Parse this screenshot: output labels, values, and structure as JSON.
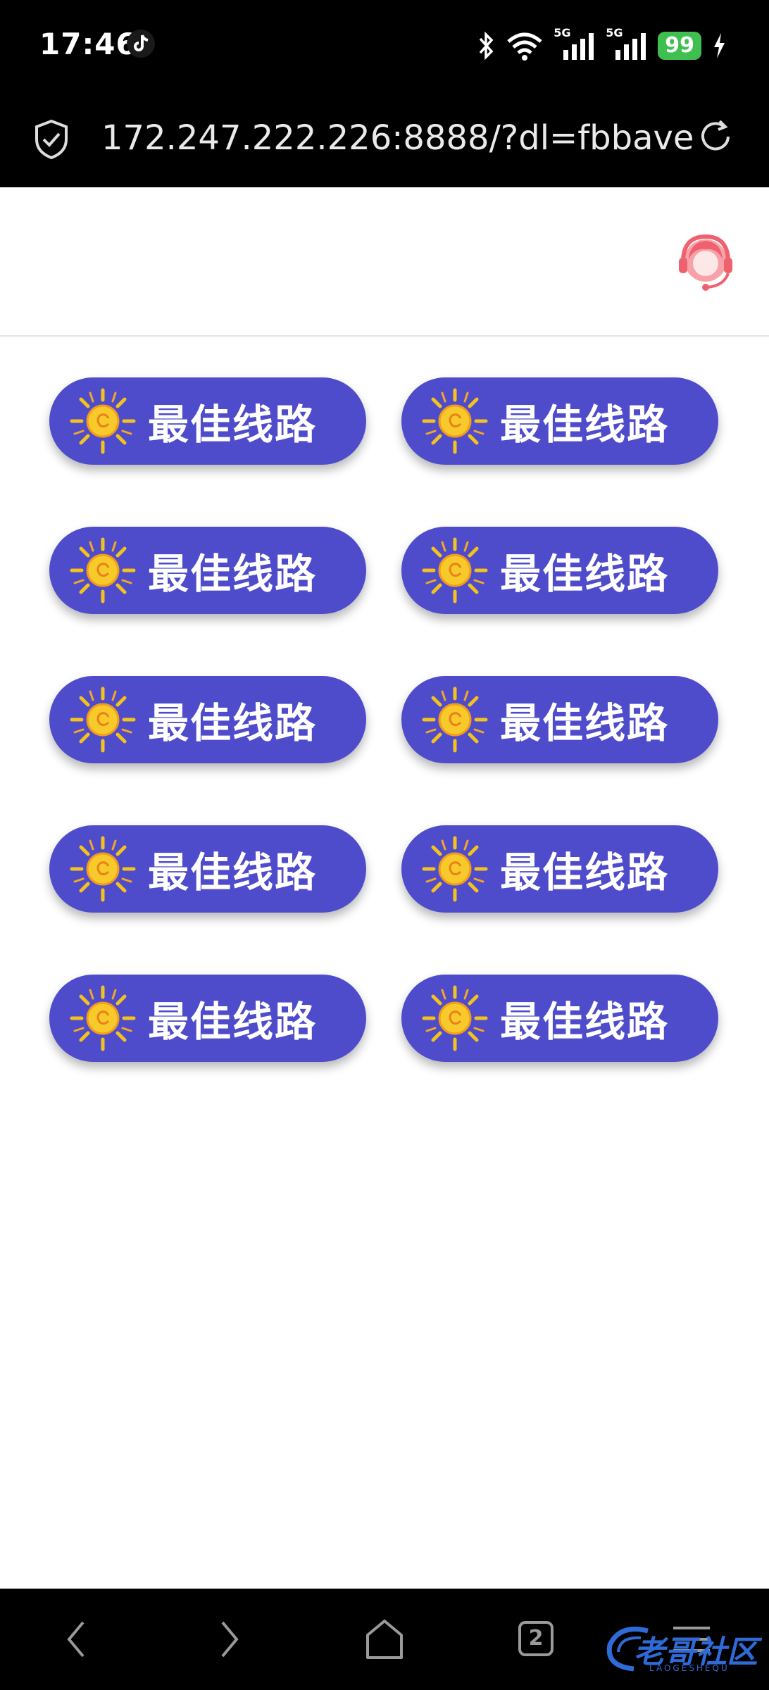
{
  "status_bar": {
    "time": "17:46",
    "network_1": "5G",
    "network_2": "5G",
    "battery": "99"
  },
  "browser": {
    "url": "172.247.222.226:8888/?dl=fbbave",
    "tab_count": "2"
  },
  "lines": [
    {
      "label": "最佳线路"
    },
    {
      "label": "最佳线路"
    },
    {
      "label": "最佳线路"
    },
    {
      "label": "最佳线路"
    },
    {
      "label": "最佳线路"
    },
    {
      "label": "最佳线路"
    },
    {
      "label": "最佳线路"
    },
    {
      "label": "最佳线路"
    },
    {
      "label": "最佳线路"
    },
    {
      "label": "最佳线路"
    }
  ],
  "watermark": {
    "text": "老哥社区",
    "sub": "LAOGESHEQU"
  },
  "colors": {
    "button": "#4f4ccc",
    "battery": "#3fbf4f",
    "support_icon": "#f0616f"
  }
}
